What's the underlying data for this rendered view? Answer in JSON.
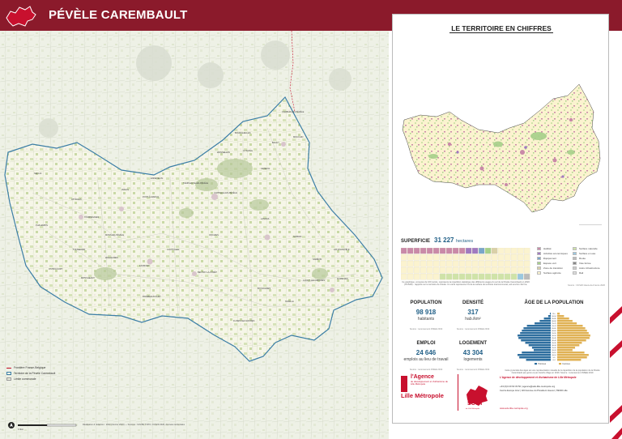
{
  "header": {
    "title": "PÉVÈLE CAREMBAULT"
  },
  "map": {
    "towns": [
      "CAMPHIN-EN-PÉVÈLE",
      "MOUCHIN",
      "BACHY",
      "BOURGHELLES",
      "WANNEHAIN",
      "CYSOING",
      "GENECH",
      "CAPPELLE-EN-PÉVÈLE",
      "TEMPLEUVE-EN-PÉVÈLE",
      "ENNEVELIN",
      "PONT-À-MARCQ",
      "AVELIN",
      "SECLIN",
      "ATTICHES",
      "PHALEMPIN",
      "TOURMIGNIES",
      "MONS-EN-PÉVÈLE",
      "THUMERIES",
      "WAHAGNIES",
      "OSTRICOURT",
      "MONCHEAUX",
      "RAIMBEAUCOURT",
      "FAUMONT",
      "COUTICHES",
      "ORCHIES",
      "LANDAS",
      "BEUVRY-LA-FORÊT",
      "NOMAIN",
      "AIX-EN-PÉVÈLE",
      "SAMÉON",
      "RUMEGIES",
      "AUCHY-LEZ-ORCHIES",
      "NIVELLE",
      "BOUVIGNIES",
      "FLINES-LEZ-RACHES"
    ],
    "legend": [
      {
        "label": "Frontière France-Belgique",
        "color": "#c8102e"
      },
      {
        "label": "Territoire de la Pévèle Carembault",
        "color": "#3b7ea6"
      },
      {
        "label": "Limite communale",
        "color": "#9a9a9a"
      }
    ],
    "scale_label": "0 4km",
    "credits": "Réalisation & rédaction : 2023 (Février 2023) — Sources : IGN BD TOPO, OCS2D 2020, données territoriales"
  },
  "panel": {
    "title": "LE TERRITOIRE EN CHIFFRES",
    "superficie": {
      "label": "SUPERFICIE",
      "value": "31 227",
      "unit": "hectares",
      "note": "Ce graphique, composé de 160 carrés, représente la répartition statistique des différents usages du sol de la Pévèle Carembault en 2020 (OCS2D) - rapporté sur le territoire de l'étude. Un carré représente 1% de la surface du territoire intercommunal, soit environ 312 ha.",
      "source": "Source : OCS2D Hauts-de-France 2020",
      "waffle": [
        {
          "category": "Habitat",
          "count": 10,
          "color": "#c98aa8"
        },
        {
          "category": "Activités économiques",
          "count": 2,
          "color": "#a07ac0"
        },
        {
          "category": "Équipement",
          "count": 1,
          "color": "#7aa6c9"
        },
        {
          "category": "Espace vert",
          "count": 1,
          "color": "#a6d08a"
        },
        {
          "category": "Zone de transition",
          "count": 1,
          "color": "#d9d0a8"
        },
        {
          "category": "Surface agricole",
          "count": 71,
          "color": "#fbf3cf"
        },
        {
          "category": "Surface naturelle",
          "count": 12,
          "color": "#cfe3a8"
        },
        {
          "category": "Surface en eau",
          "count": 1,
          "color": "#9bc8e0"
        },
        {
          "category": "Route",
          "count": 1,
          "color": "#bbbbbb"
        }
      ],
      "legend_left": [
        "Habitat",
        "Activités économiques",
        "Équipement",
        "Espace vert",
        "Zone de transition",
        "Surface agricole"
      ],
      "legend_right": [
        "Surface naturelle",
        "Surface en eau",
        "Route",
        "Voie ferrée",
        "Autre infrastructure",
        "Rail"
      ],
      "legend_left_colors": [
        "#c98aa8",
        "#a07ac0",
        "#7aa6c9",
        "#a6d08a",
        "#d9d0a8",
        "#fbf3cf"
      ],
      "legend_right_colors": [
        "#cfe3a8",
        "#9bc8e0",
        "#bbbbbb",
        "#888888",
        "#cccccc",
        "#dddddd"
      ]
    },
    "population": {
      "label": "POPULATION",
      "value": "98 918",
      "unit": "habitants",
      "source": "Source : recensement INSEE 2019"
    },
    "densite": {
      "label": "DENSITÉ",
      "value": "317",
      "unit": "hab./km²",
      "source": "Source : recensement INSEE 2019"
    },
    "emploi": {
      "label": "EMPLOI",
      "value": "24 646",
      "unit": "emplois au lieu de travail",
      "source": "Source : recensement INSEE 2019"
    },
    "logement": {
      "label": "LOGEMENT",
      "value": "43 304",
      "unit": "logements",
      "source": "Source : recensement INSEE 2019"
    },
    "pyramid": {
      "title": "ÂGE DE LA POPULATION",
      "legend_men": "Hommes",
      "legend_women": "Femmes",
      "note": "Cette pyramide des âges est une représentation visuelle de la répartition de la population de la Pévèle Carembault par genre et par tranche d'âge en 2019. Source : recensement INSEE 2019"
    },
    "contact": {
      "title": "L'Agence de développement et d'urbanisme de Lille Métropole",
      "lines": [
        "+33 (0)3 20 63 33 50 | agence@adu-lille-metropole.org",
        "Centre Europe Azur | 323 Avenue du Président Hoover | 59000 Lille"
      ],
      "site": "www.adu-lille-metropole.org"
    },
    "logo_agence": {
      "name": "l'Agence",
      "sub": "de développement et d'urbanisme de Lille Métropole",
      "city": "Lille Métropole"
    },
    "logo_scot": {
      "name": "SCOT",
      "sub": "de Lille Métropole"
    }
  },
  "chart_data": {
    "type": "bar",
    "title": "ÂGE DE LA POPULATION",
    "categories": [
      "95+",
      "90-94",
      "85-89",
      "80-84",
      "75-79",
      "70-74",
      "65-69",
      "60-64",
      "55-59",
      "50-54",
      "45-49",
      "40-44",
      "35-39",
      "30-34",
      "25-29",
      "20-24",
      "15-19",
      "10-14",
      "5-9",
      "0-4"
    ],
    "series": [
      {
        "name": "Hommes",
        "color": "#2f6f9f",
        "values": [
          0.1,
          0.3,
          0.8,
          1.3,
          1.9,
          2.8,
          3.2,
          3.4,
          3.6,
          3.9,
          3.8,
          3.5,
          3.0,
          2.6,
          2.2,
          2.0,
          3.4,
          3.9,
          3.7,
          2.9
        ]
      },
      {
        "name": "Femmes",
        "color": "#e0b255",
        "values": [
          0.3,
          0.8,
          1.4,
          1.8,
          2.3,
          3.0,
          3.3,
          3.5,
          3.7,
          3.9,
          3.8,
          3.4,
          2.9,
          2.6,
          2.1,
          1.8,
          3.2,
          3.7,
          3.5,
          2.8
        ]
      }
    ],
    "xlabel": "",
    "ylabel": ""
  }
}
